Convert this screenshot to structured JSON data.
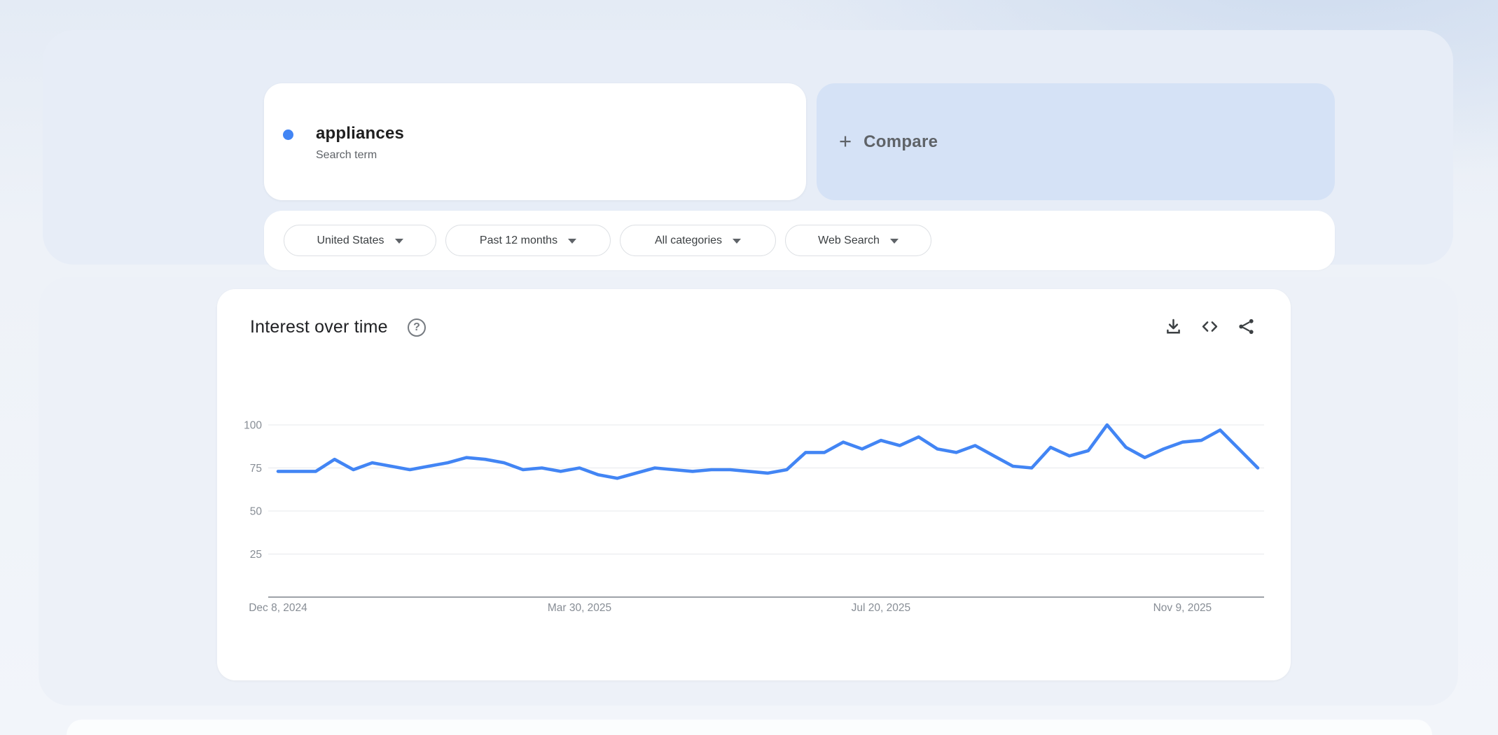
{
  "colors": {
    "accent_blue": "#4285f4",
    "compare_bg": "#d5e2f6",
    "text_dark": "#202124",
    "text_grey": "#5f6368",
    "axis_label_grey": "#878d95",
    "gridline_grey": "#e7e9ec"
  },
  "term_card": {
    "term": "appliances",
    "kind": "Search term"
  },
  "compare_card": {
    "plus": "+",
    "label": "Compare"
  },
  "filters": [
    {
      "label": "United States"
    },
    {
      "label": "Past 12 months"
    },
    {
      "label": "All categories"
    },
    {
      "label": "Web Search"
    }
  ],
  "chart_section": {
    "title": "Interest over time",
    "help": "?"
  },
  "chart_data": {
    "type": "line",
    "title": "Interest over time",
    "series": [
      {
        "name": "appliances",
        "color": "#4285f4",
        "values": [
          73,
          73,
          73,
          80,
          74,
          78,
          76,
          74,
          76,
          78,
          81,
          80,
          78,
          74,
          75,
          73,
          75,
          71,
          69,
          72,
          75,
          74,
          73,
          74,
          74,
          73,
          72,
          74,
          84,
          84,
          90,
          86,
          91,
          88,
          93,
          86,
          84,
          88,
          82,
          76,
          75,
          87,
          82,
          85,
          100,
          87,
          81,
          86,
          90,
          91,
          97,
          86,
          75
        ]
      }
    ],
    "x_unit": "weeks",
    "x_tick_labels": [
      "Dec 8, 2024",
      "Mar 30, 2025",
      "Jul 20, 2025",
      "Nov 9, 2025"
    ],
    "x_tick_indices": [
      0,
      16,
      32,
      48
    ],
    "y_ticks": [
      25,
      50,
      75,
      100
    ],
    "ylim": [
      0,
      100
    ],
    "grid": true,
    "legend": "none"
  }
}
